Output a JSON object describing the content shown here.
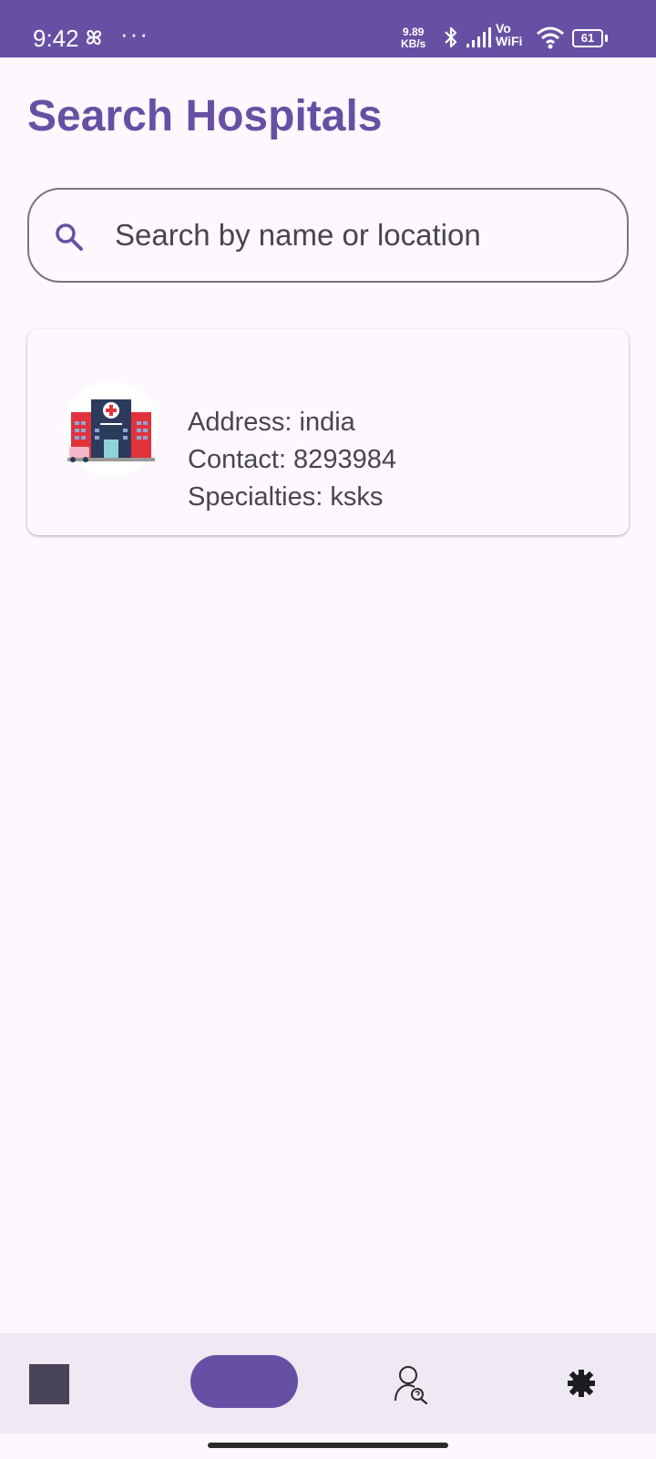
{
  "status_bar": {
    "time": "9:42",
    "dots": "···",
    "speed_value": "9.89",
    "speed_unit": "KB/s",
    "vo": "Vo",
    "wifi_label": "WiFi",
    "battery": "61",
    "bg_color": "#6750a4"
  },
  "page": {
    "title": "Search Hospitals",
    "accent_color": "#6750a4"
  },
  "search": {
    "placeholder": "Search by name or location",
    "value": "",
    "icon": "search-icon"
  },
  "hospitals": [
    {
      "icon": "hospital-building-icon",
      "address": "Address: india",
      "contact": "Contact: 8293984",
      "specialties": "Specialties: ksks"
    }
  ],
  "bottom_nav": {
    "items": [
      {
        "icon": "square-icon"
      },
      {
        "icon": "active-pill-icon",
        "selected": true
      },
      {
        "icon": "person-search-icon"
      },
      {
        "icon": "gear-icon"
      }
    ]
  }
}
